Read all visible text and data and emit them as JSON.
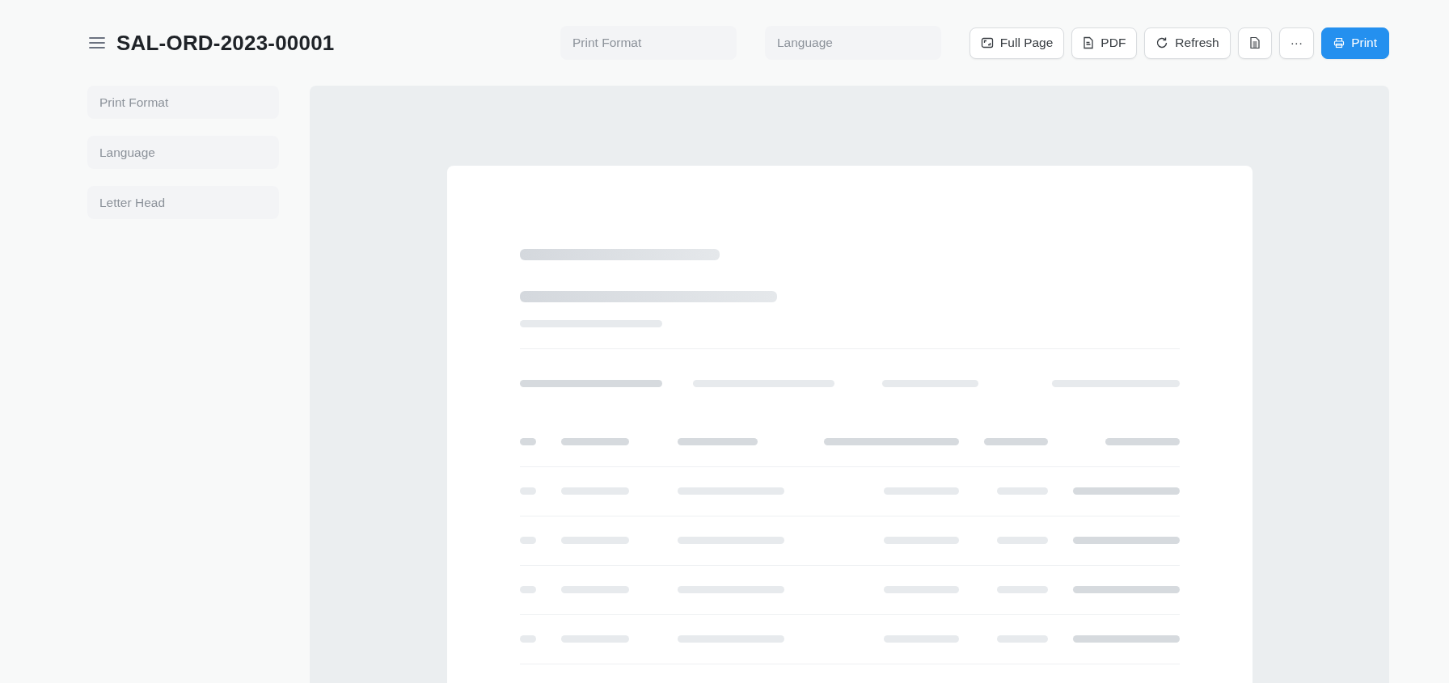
{
  "title": "SAL-ORD-2023-00001",
  "header_fields": [
    {
      "placeholder": "Print Format"
    },
    {
      "placeholder": "Language"
    }
  ],
  "buttons": [
    {
      "kind": "full-page",
      "label": "Full Page",
      "primary": false
    },
    {
      "kind": "pdf",
      "label": "PDF",
      "primary": false
    },
    {
      "kind": "refresh",
      "label": "Refresh",
      "primary": false
    },
    {
      "kind": "document",
      "primary": false
    },
    {
      "kind": "more",
      "label": "···",
      "primary": false
    },
    {
      "kind": "print",
      "label": "Print",
      "primary": true
    }
  ],
  "sidebar_fields": [
    {
      "placeholder": "Print Format"
    },
    {
      "placeholder": "Language"
    },
    {
      "placeholder": "Letter Head"
    }
  ]
}
